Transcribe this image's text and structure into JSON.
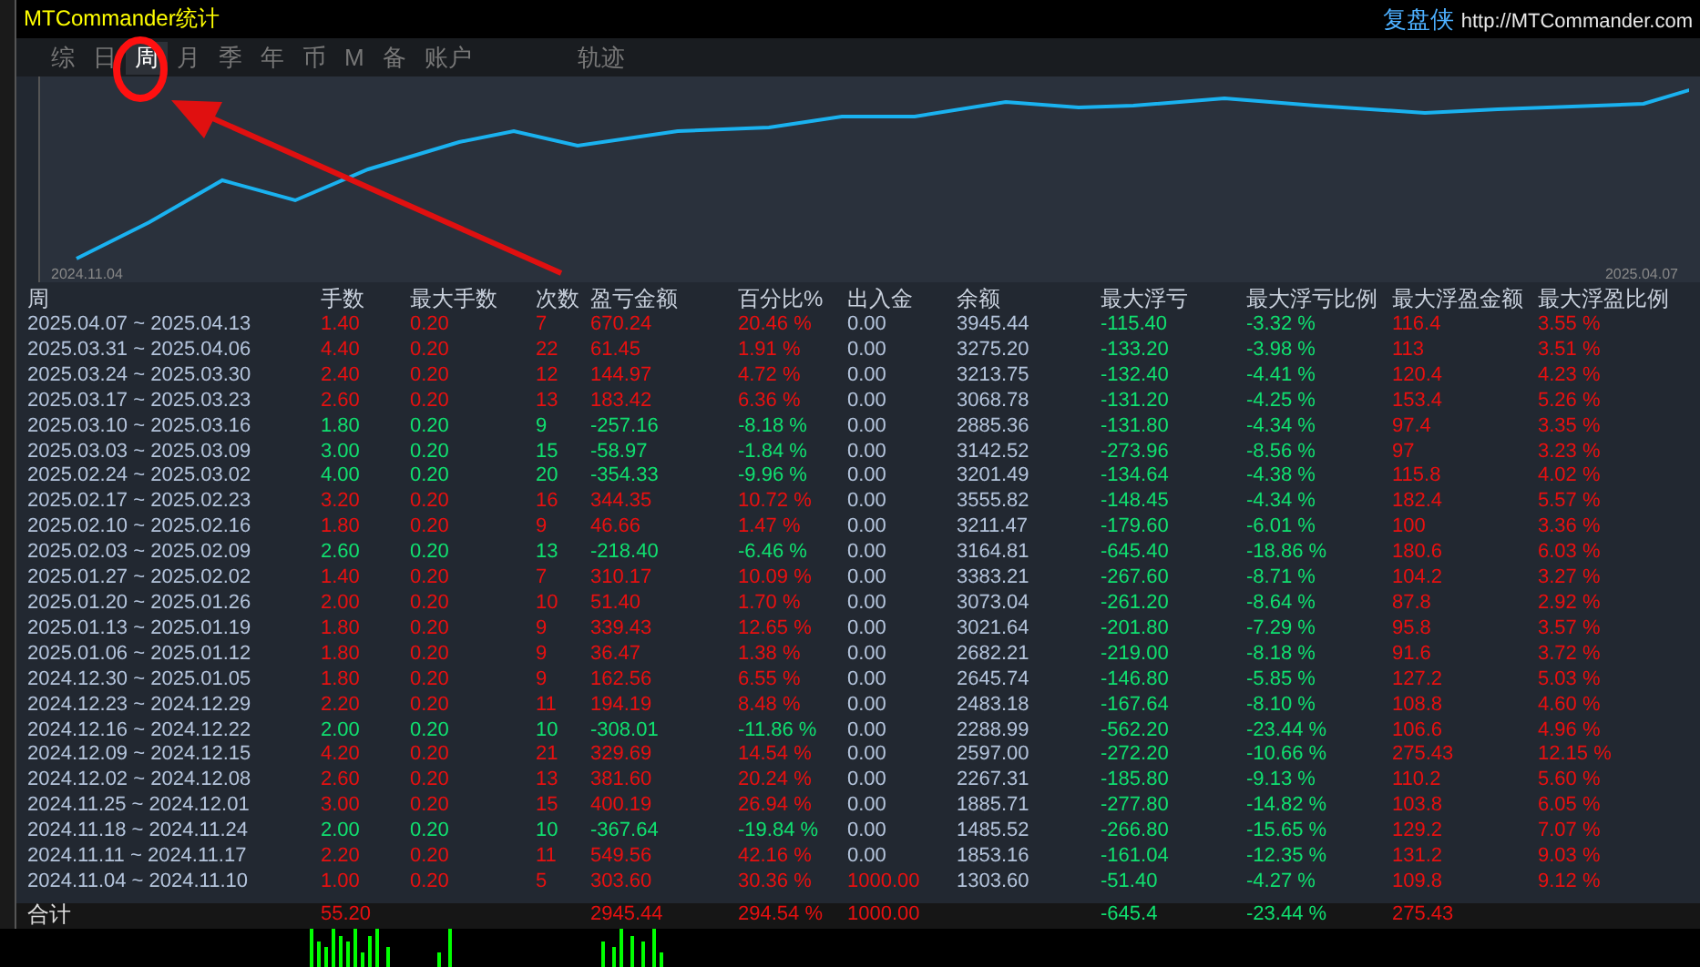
{
  "window": {
    "title": "MTCommander统计",
    "brand": "复盘侠",
    "url": "http://MTCommander.com"
  },
  "tabs": [
    {
      "label": "综",
      "selected": false
    },
    {
      "label": "日",
      "selected": false
    },
    {
      "label": "周",
      "selected": true
    },
    {
      "label": "月",
      "selected": false
    },
    {
      "label": "季",
      "selected": false
    },
    {
      "label": "年",
      "selected": false
    },
    {
      "label": "币",
      "selected": false
    },
    {
      "label": "M",
      "selected": false
    },
    {
      "label": "备",
      "selected": false
    },
    {
      "label": "账户",
      "selected": false
    },
    {
      "label": "轨迹",
      "selected": false
    }
  ],
  "chart": {
    "start_label": "2024.11.04",
    "end_label": "2025.04.07"
  },
  "table": {
    "columns": [
      "周",
      "手数",
      "最大手数",
      "次数",
      "盈亏金额",
      "百分比%",
      "出入金",
      "余额",
      "最大浮亏",
      "最大浮亏比例",
      "最大浮盈金额",
      "最大浮盈比例"
    ],
    "rows": [
      {
        "kind": "gain",
        "deposit_highlight": false,
        "cells": [
          "2025.04.07 ~ 2025.04.13",
          "1.40",
          "0.20",
          "7",
          "670.24",
          "20.46 %",
          "0.00",
          "3945.44",
          "-115.40",
          "-3.32 %",
          "116.4",
          "3.55 %"
        ]
      },
      {
        "kind": "gain",
        "deposit_highlight": false,
        "cells": [
          "2025.03.31 ~ 2025.04.06",
          "4.40",
          "0.20",
          "22",
          "61.45",
          "1.91 %",
          "0.00",
          "3275.20",
          "-133.20",
          "-3.98 %",
          "113",
          "3.51 %"
        ]
      },
      {
        "kind": "gain",
        "deposit_highlight": false,
        "cells": [
          "2025.03.24 ~ 2025.03.30",
          "2.40",
          "0.20",
          "12",
          "144.97",
          "4.72 %",
          "0.00",
          "3213.75",
          "-132.40",
          "-4.41 %",
          "120.4",
          "4.23 %"
        ]
      },
      {
        "kind": "gain",
        "deposit_highlight": false,
        "cells": [
          "2025.03.17 ~ 2025.03.23",
          "2.60",
          "0.20",
          "13",
          "183.42",
          "6.36 %",
          "0.00",
          "3068.78",
          "-131.20",
          "-4.25 %",
          "153.4",
          "5.26 %"
        ]
      },
      {
        "kind": "loss",
        "deposit_highlight": false,
        "cells": [
          "2025.03.10 ~ 2025.03.16",
          "1.80",
          "0.20",
          "9",
          "-257.16",
          "-8.18 %",
          "0.00",
          "2885.36",
          "-131.80",
          "-4.34 %",
          "97.4",
          "3.35 %"
        ]
      },
      {
        "kind": "loss",
        "deposit_highlight": false,
        "cells": [
          "2025.03.03 ~ 2025.03.09",
          "3.00",
          "0.20",
          "15",
          "-58.97",
          "-1.84 %",
          "0.00",
          "3142.52",
          "-273.96",
          "-8.56 %",
          "97",
          "3.23 %"
        ]
      },
      {
        "kind": "loss",
        "deposit_highlight": false,
        "cells": [
          "2025.02.24 ~ 2025.03.02",
          "4.00",
          "0.20",
          "20",
          "-354.33",
          "-9.96 %",
          "0.00",
          "3201.49",
          "-134.64",
          "-4.38 %",
          "115.8",
          "4.02 %"
        ]
      },
      {
        "kind": "gain",
        "deposit_highlight": false,
        "cells": [
          "2025.02.17 ~ 2025.02.23",
          "3.20",
          "0.20",
          "16",
          "344.35",
          "10.72 %",
          "0.00",
          "3555.82",
          "-148.45",
          "-4.34 %",
          "182.4",
          "5.57 %"
        ]
      },
      {
        "kind": "gain",
        "deposit_highlight": false,
        "cells": [
          "2025.02.10 ~ 2025.02.16",
          "1.80",
          "0.20",
          "9",
          "46.66",
          "1.47 %",
          "0.00",
          "3211.47",
          "-179.60",
          "-6.01 %",
          "100",
          "3.36 %"
        ]
      },
      {
        "kind": "loss",
        "deposit_highlight": false,
        "cells": [
          "2025.02.03 ~ 2025.02.09",
          "2.60",
          "0.20",
          "13",
          "-218.40",
          "-6.46 %",
          "0.00",
          "3164.81",
          "-645.40",
          "-18.86 %",
          "180.6",
          "6.03 %"
        ]
      },
      {
        "kind": "gain",
        "deposit_highlight": false,
        "cells": [
          "2025.01.27 ~ 2025.02.02",
          "1.40",
          "0.20",
          "7",
          "310.17",
          "10.09 %",
          "0.00",
          "3383.21",
          "-267.60",
          "-8.71 %",
          "104.2",
          "3.27 %"
        ]
      },
      {
        "kind": "gain",
        "deposit_highlight": false,
        "cells": [
          "2025.01.20 ~ 2025.01.26",
          "2.00",
          "0.20",
          "10",
          "51.40",
          "1.70 %",
          "0.00",
          "3073.04",
          "-261.20",
          "-8.64 %",
          "87.8",
          "2.92 %"
        ]
      },
      {
        "kind": "gain",
        "deposit_highlight": false,
        "cells": [
          "2025.01.13 ~ 2025.01.19",
          "1.80",
          "0.20",
          "9",
          "339.43",
          "12.65 %",
          "0.00",
          "3021.64",
          "-201.80",
          "-7.29 %",
          "95.8",
          "3.57 %"
        ]
      },
      {
        "kind": "gain",
        "deposit_highlight": false,
        "cells": [
          "2025.01.06 ~ 2025.01.12",
          "1.80",
          "0.20",
          "9",
          "36.47",
          "1.38 %",
          "0.00",
          "2682.21",
          "-219.00",
          "-8.18 %",
          "91.6",
          "3.72 %"
        ]
      },
      {
        "kind": "gain",
        "deposit_highlight": false,
        "cells": [
          "2024.12.30 ~ 2025.01.05",
          "1.80",
          "0.20",
          "9",
          "162.56",
          "6.55 %",
          "0.00",
          "2645.74",
          "-146.80",
          "-5.85 %",
          "127.2",
          "5.03 %"
        ]
      },
      {
        "kind": "gain",
        "deposit_highlight": false,
        "cells": [
          "2024.12.23 ~ 2024.12.29",
          "2.20",
          "0.20",
          "11",
          "194.19",
          "8.48 %",
          "0.00",
          "2483.18",
          "-167.64",
          "-8.10 %",
          "108.8",
          "4.60 %"
        ]
      },
      {
        "kind": "loss",
        "deposit_highlight": false,
        "cells": [
          "2024.12.16 ~ 2024.12.22",
          "2.00",
          "0.20",
          "10",
          "-308.01",
          "-11.86 %",
          "0.00",
          "2288.99",
          "-562.20",
          "-23.44 %",
          "106.6",
          "4.96 %"
        ]
      },
      {
        "kind": "gain",
        "deposit_highlight": false,
        "cells": [
          "2024.12.09 ~ 2024.12.15",
          "4.20",
          "0.20",
          "21",
          "329.69",
          "14.54 %",
          "0.00",
          "2597.00",
          "-272.20",
          "-10.66 %",
          "275.43",
          "12.15 %"
        ]
      },
      {
        "kind": "gain",
        "deposit_highlight": false,
        "cells": [
          "2024.12.02 ~ 2024.12.08",
          "2.60",
          "0.20",
          "13",
          "381.60",
          "20.24 %",
          "0.00",
          "2267.31",
          "-185.80",
          "-9.13 %",
          "110.2",
          "5.60 %"
        ]
      },
      {
        "kind": "gain",
        "deposit_highlight": false,
        "cells": [
          "2024.11.25 ~ 2024.12.01",
          "3.00",
          "0.20",
          "15",
          "400.19",
          "26.94 %",
          "0.00",
          "1885.71",
          "-277.80",
          "-14.82 %",
          "103.8",
          "6.05 %"
        ]
      },
      {
        "kind": "loss",
        "deposit_highlight": false,
        "cells": [
          "2024.11.18 ~ 2024.11.24",
          "2.00",
          "0.20",
          "10",
          "-367.64",
          "-19.84 %",
          "0.00",
          "1485.52",
          "-266.80",
          "-15.65 %",
          "129.2",
          "7.07 %"
        ]
      },
      {
        "kind": "gain",
        "deposit_highlight": false,
        "cells": [
          "2024.11.11 ~ 2024.11.17",
          "2.20",
          "0.20",
          "11",
          "549.56",
          "42.16 %",
          "0.00",
          "1853.16",
          "-161.04",
          "-12.35 %",
          "131.2",
          "9.03 %"
        ]
      },
      {
        "kind": "gain",
        "deposit_highlight": true,
        "cells": [
          "2024.11.04 ~ 2024.11.10",
          "1.00",
          "0.20",
          "5",
          "303.60",
          "30.36 %",
          "1000.00",
          "1303.60",
          "-51.40",
          "-4.27 %",
          "109.8",
          "9.12 %"
        ]
      }
    ],
    "total": {
      "label": "合计",
      "cells": [
        "55.20",
        "",
        "",
        "2945.44",
        "294.54 %",
        "1000.00",
        "",
        "-645.4",
        "-23.44 %",
        "275.43",
        ""
      ]
    }
  }
}
